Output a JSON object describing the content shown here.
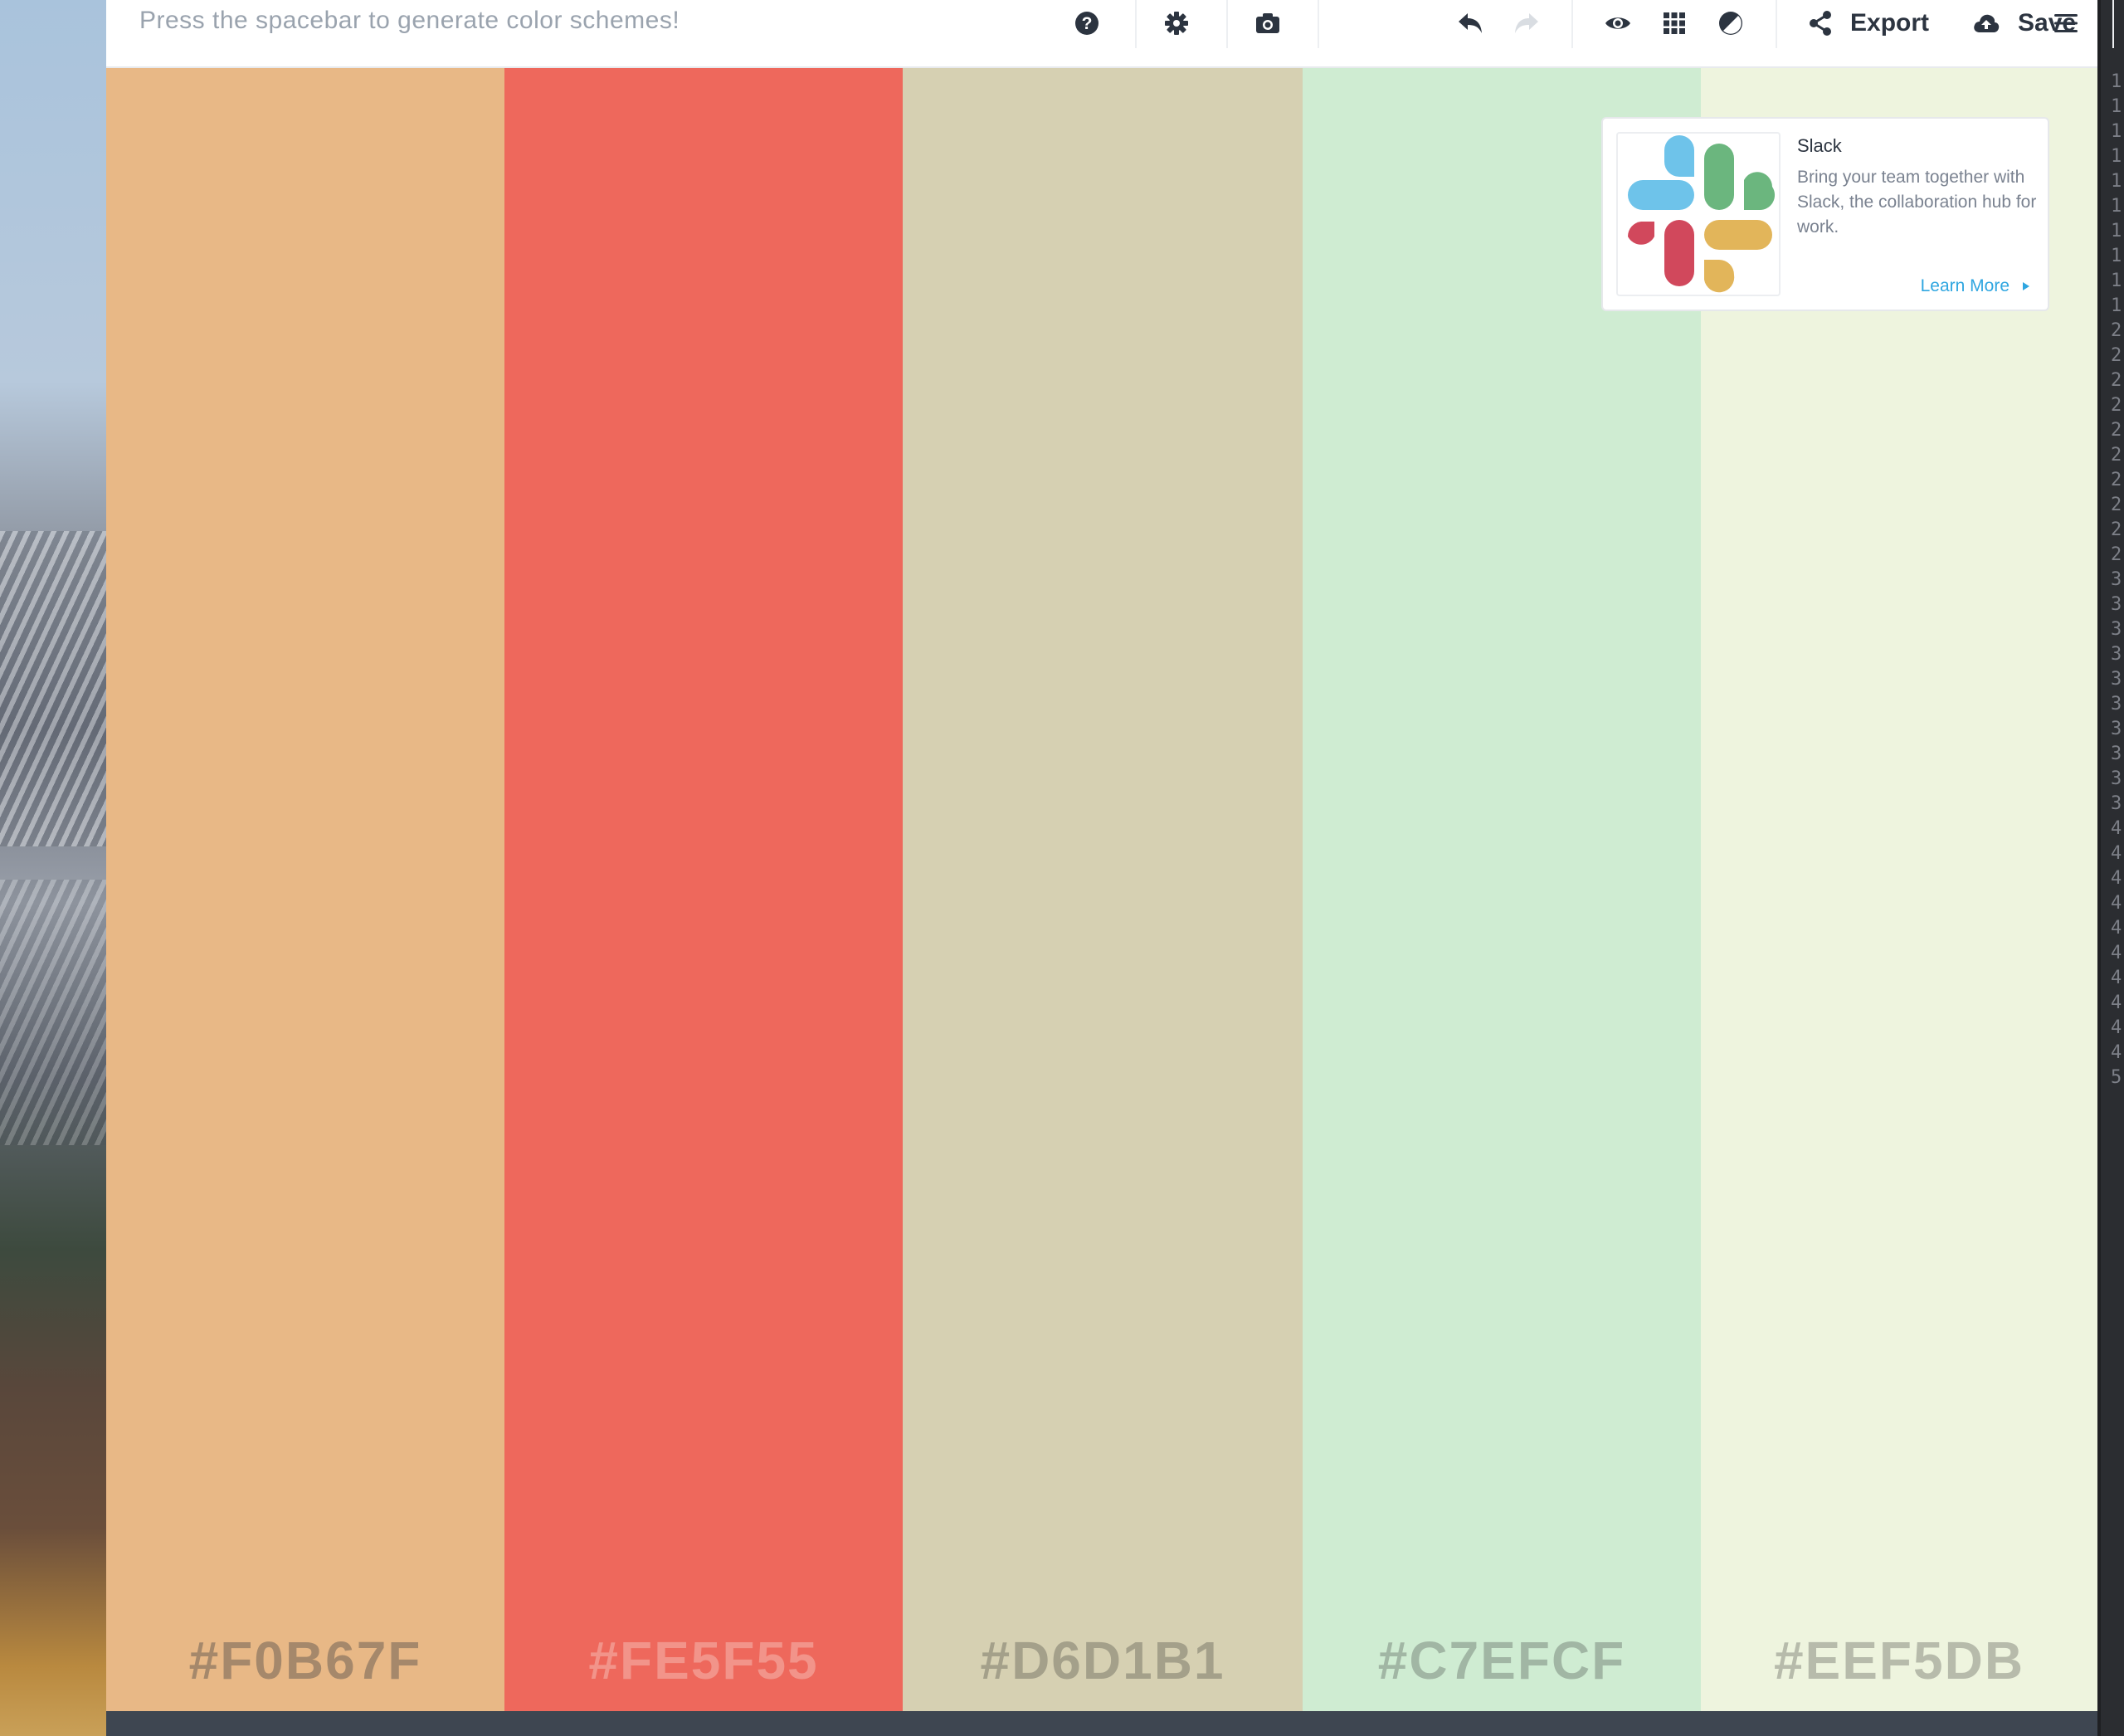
{
  "toolbar": {
    "hint": "Press the spacebar to generate color schemes!",
    "export_label": "Export",
    "save_label": "Save",
    "icons": [
      "help-icon",
      "settings-icon",
      "camera-icon",
      "undo-icon",
      "redo-icon",
      "view-icon",
      "grid-icon",
      "contrast-icon",
      "share-icon",
      "cloud-upload-icon",
      "menu-icon"
    ]
  },
  "palette": {
    "swatches": [
      {
        "hex": "#F0B67F",
        "bg": "#e8b886",
        "text_color": "#a5886b"
      },
      {
        "hex": "#FE5F55",
        "bg": "#ee685c",
        "text_color": "#f2948a"
      },
      {
        "hex": "#D6D1B1",
        "bg": "#d6d0b2",
        "text_color": "#a4a08a"
      },
      {
        "hex": "#C7EFCF",
        "bg": "#cfecd2",
        "text_color": "#a1b6a4"
      },
      {
        "hex": "#EEF5DB",
        "bg": "#eef4de",
        "text_color": "#b7bbab"
      }
    ]
  },
  "ad": {
    "title": "Slack",
    "description": "Bring your team together with Slack, the collaboration hub for work.",
    "cta": "Learn More",
    "logo_colors": {
      "blue": "#6ec3ea",
      "green": "#6bb67e",
      "red": "#d1485c",
      "yellow": "#e2b55a"
    }
  },
  "editor": {
    "line_numbers": [
      "1",
      "1",
      "1",
      "1",
      "1",
      "1",
      "1",
      "1",
      "1",
      "1",
      "2",
      "2",
      "2",
      "2",
      "2",
      "2",
      "2",
      "2",
      "2",
      "2",
      "3",
      "3",
      "3",
      "3",
      "3",
      "3",
      "3",
      "3",
      "3",
      "3",
      "4",
      "4",
      "4",
      "4",
      "4",
      "4",
      "4",
      "4",
      "4",
      "4",
      "5"
    ]
  }
}
